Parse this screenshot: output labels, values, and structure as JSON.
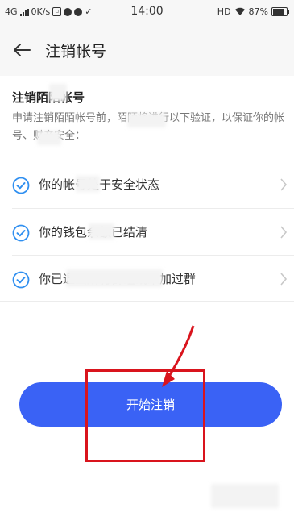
{
  "status_bar": {
    "network": "4G",
    "speed": "0K/s",
    "time": "14:00",
    "hd": "HD",
    "battery": "87%"
  },
  "nav": {
    "title": "注销帐号",
    "back_icon": "arrow-left-icon"
  },
  "content": {
    "section_title": "注销陌陌帐号",
    "description": "申请注销陌陌帐号前，陌陌将进行以下验证，以保证你的帐号、财产安全："
  },
  "checks": [
    {
      "label": "你的帐号处于安全状态",
      "icon": "check-circle-icon",
      "chevron": "chevron-right-icon"
    },
    {
      "label": "你的钱包余额已结清",
      "icon": "check-circle-icon",
      "chevron": "chevron-right-icon"
    },
    {
      "label": "你已退出所有群组或未加过群",
      "icon": "check-circle-icon",
      "chevron": "chevron-right-icon"
    }
  ],
  "button": {
    "label": "开始注销"
  },
  "colors": {
    "accent": "#3a62f5",
    "check": "#2f8ff0",
    "annotation": "#d9141d"
  }
}
